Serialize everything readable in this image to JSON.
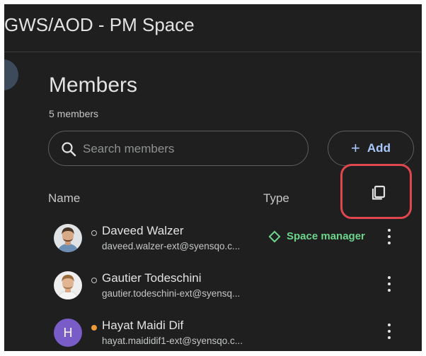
{
  "header": {
    "space_title": "GWS/AOD - PM Space"
  },
  "panel": {
    "title": "Members",
    "member_count": "5 members",
    "search": {
      "placeholder": "Search members"
    },
    "add_button": {
      "icon": "plus",
      "label": "Add"
    },
    "columns": {
      "name": "Name",
      "type": "Type"
    },
    "copy_button": {
      "icon": "copy-icon",
      "highlighted": true,
      "highlight_color": "#e0464e"
    }
  },
  "members": [
    {
      "name": "Daveed Walzer",
      "email": "daveed.walzer-ext@syensqo.c...",
      "status": "offline",
      "role": "Space manager",
      "avatar": "photo"
    },
    {
      "name": "Gautier Todeschini",
      "email": "gautier.todeschini-ext@syensq...",
      "status": "offline",
      "role": "",
      "avatar": "photo"
    },
    {
      "name": "Hayat Maidi Dif",
      "email": "hayat.maididif1-ext@syensqo.c...",
      "status": "away",
      "role": "",
      "avatar": "letter",
      "avatar_letter": "H"
    }
  ],
  "colors": {
    "background": "#1f1f1f",
    "accent_link": "#a8c7fa",
    "role_green": "#6dd58c",
    "away_orange": "#f09a35",
    "avatar_purple": "#7a5cc9"
  }
}
